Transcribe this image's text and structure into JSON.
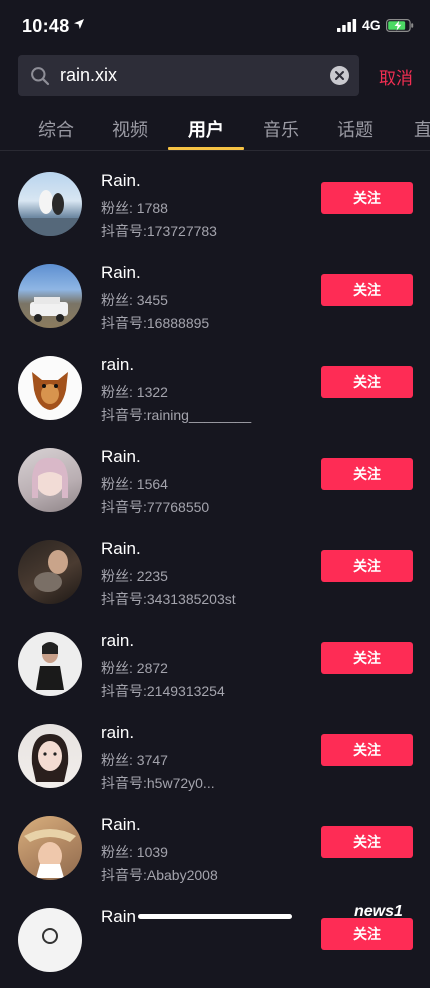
{
  "status_bar": {
    "time": "10:48",
    "network": "4G"
  },
  "search": {
    "query": "rain.xix",
    "cancel_label": "取消"
  },
  "tabs": [
    {
      "label": "综合"
    },
    {
      "label": "视频"
    },
    {
      "label": "用户"
    },
    {
      "label": "音乐"
    },
    {
      "label": "话题"
    },
    {
      "label": "直"
    }
  ],
  "active_tab": "用户",
  "users": [
    {
      "name": "Rain.",
      "fans": "粉丝: 1788",
      "douyin_id": "抖音号:173727783",
      "follow_label": "关注"
    },
    {
      "name": "Rain.",
      "fans": "粉丝: 3455",
      "douyin_id": "抖音号:16888895",
      "follow_label": "关注"
    },
    {
      "name": "rain.",
      "fans": "粉丝: 1322",
      "douyin_id": "抖音号:raining________",
      "follow_label": "关注"
    },
    {
      "name": "Rain.",
      "fans": "粉丝: 1564",
      "douyin_id": "抖音号:77768550",
      "follow_label": "关注"
    },
    {
      "name": "Rain.",
      "fans": "粉丝: 2235",
      "douyin_id": "抖音号:3431385203st",
      "follow_label": "关注"
    },
    {
      "name": "rain.",
      "fans": "粉丝: 2872",
      "douyin_id": "抖音号:2149313254",
      "follow_label": "关注"
    },
    {
      "name": "rain.",
      "fans": "粉丝: 3747",
      "douyin_id": "抖音号:h5w72y0...",
      "follow_label": "关注"
    },
    {
      "name": "Rain.",
      "fans": "粉丝: 1039",
      "douyin_id": "抖音号:Ababy2008",
      "follow_label": "关注"
    },
    {
      "name": "Rain",
      "fans": "",
      "douyin_id": "",
      "follow_label": "关注"
    }
  ],
  "watermark": "news1",
  "colors": {
    "background": "#16161f",
    "accent": "#fe2c55",
    "tab_indicator": "#f6c244",
    "cancel": "#f02e52"
  }
}
